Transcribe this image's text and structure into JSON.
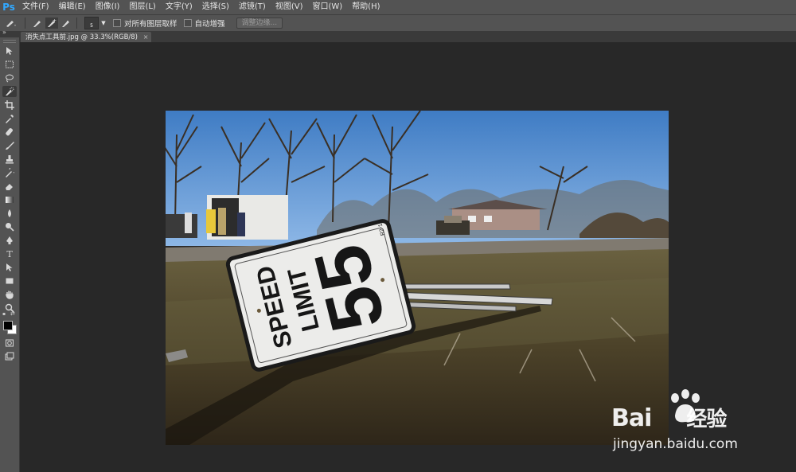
{
  "app": {
    "logo": "Ps",
    "menu": [
      "文件(F)",
      "编辑(E)",
      "图像(I)",
      "图层(L)",
      "文字(Y)",
      "选择(S)",
      "滤镜(T)",
      "视图(V)",
      "窗口(W)",
      "帮助(H)"
    ]
  },
  "options": {
    "brush_size": "5",
    "sample_all_layers_label": "对所有图层取样",
    "auto_enhance_label": "自动增强",
    "refine_edge_label": "调整边缘..."
  },
  "document": {
    "tab_title": "消失点工具前.jpg @ 33.3%(RGB/8)",
    "close_glyph": "×"
  },
  "tools": [
    "move-tool",
    "marquee-tool",
    "lasso-tool",
    "quick-selection-tool",
    "crop-tool",
    "eyedropper-tool",
    "spot-healing-tool",
    "brush-tool",
    "clone-stamp-tool",
    "history-brush-tool",
    "eraser-tool",
    "gradient-tool",
    "blur-tool",
    "dodge-tool",
    "pen-tool",
    "type-tool",
    "path-selection-tool",
    "rectangle-tool",
    "hand-tool",
    "zoom-tool"
  ],
  "colors": {
    "foreground": "#000000",
    "background": "#ffffff",
    "accent": "#31a8ff"
  },
  "photo": {
    "sign_line1": "SPEED",
    "sign_line2": "LIMIT",
    "sign_number": "55",
    "sign_code": "R2-1"
  },
  "watermark": {
    "brand": "Bai",
    "brand2": "经验",
    "site": "jingyan.baidu.com"
  }
}
